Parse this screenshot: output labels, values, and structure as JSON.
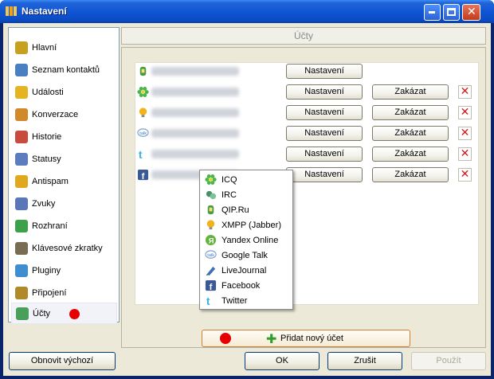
{
  "window": {
    "title": "Nastavení"
  },
  "sidebar": {
    "items": [
      {
        "label": "Hlavní",
        "icon": "home-icon",
        "color": "#c8a020"
      },
      {
        "label": "Seznam kontaktů",
        "icon": "contacts-icon",
        "color": "#4a7fc1"
      },
      {
        "label": "Události",
        "icon": "events-icon",
        "color": "#e6b422"
      },
      {
        "label": "Konverzace",
        "icon": "conversation-icon",
        "color": "#d08a2a"
      },
      {
        "label": "Historie",
        "icon": "history-icon",
        "color": "#c84b3c"
      },
      {
        "label": "Statusy",
        "icon": "status-icon",
        "color": "#5b7dbe"
      },
      {
        "label": "Antispam",
        "icon": "shield-icon",
        "color": "#e0a81c"
      },
      {
        "label": "Zvuky",
        "icon": "sound-icon",
        "color": "#5a78b8"
      },
      {
        "label": "Rozhraní",
        "icon": "interface-icon",
        "color": "#3da14a"
      },
      {
        "label": "Klávesové zkratky",
        "icon": "keyboard-icon",
        "color": "#7a6c52"
      },
      {
        "label": "Pluginy",
        "icon": "plugin-icon",
        "color": "#3f8fd0"
      },
      {
        "label": "Připojení",
        "icon": "connection-icon",
        "color": "#b08a2a"
      },
      {
        "label": "Účty",
        "icon": "accounts-icon",
        "color": "#4aa05a"
      }
    ]
  },
  "main": {
    "header": "Účty",
    "accounts": [
      {
        "icon": "qip-icon",
        "color": "#4a9a3e",
        "settings": "Nastavení"
      },
      {
        "icon": "icq-icon",
        "color": "#49b649",
        "settings": "Nastavení",
        "disable": "Zakázat"
      },
      {
        "icon": "xmpp-icon",
        "color": "#f2b21c",
        "settings": "Nastavení",
        "disable": "Zakázat"
      },
      {
        "icon": "google-talk-icon",
        "color": "#8aa1c9",
        "settings": "Nastavení",
        "disable": "Zakázat"
      },
      {
        "icon": "twitter-icon",
        "color": "#39b3e6",
        "settings": "Nastavení",
        "disable": "Zakázat"
      },
      {
        "icon": "facebook-icon",
        "color": "#3b5998",
        "settings": "Nastavení",
        "disable": "Zakázat"
      }
    ],
    "add_account": "Přidat nový účet"
  },
  "menu": {
    "items": [
      {
        "label": "ICQ",
        "icon": "icq-icon",
        "color": "#49b649"
      },
      {
        "label": "IRC",
        "icon": "irc-icon",
        "color": "#4a8f6a"
      },
      {
        "label": "QIP.Ru",
        "icon": "qip-icon",
        "color": "#4a9a3e"
      },
      {
        "label": "XMPP (Jabber)",
        "icon": "xmpp-icon",
        "color": "#f2b21c"
      },
      {
        "label": "Yandex Online",
        "icon": "yandex-icon",
        "color": "#62b43c"
      },
      {
        "label": "Google Talk",
        "icon": "google-talk-icon",
        "color": "#8aa1c9"
      },
      {
        "label": "LiveJournal",
        "icon": "livejournal-icon",
        "color": "#3f6fb5"
      },
      {
        "label": "Facebook",
        "icon": "facebook-icon",
        "color": "#3b5998"
      },
      {
        "label": "Twitter",
        "icon": "twitter-icon",
        "color": "#39b3e6"
      }
    ]
  },
  "footer": {
    "reset": "Obnovit výchozí",
    "ok": "OK",
    "cancel": "Zrušit",
    "apply": "Použít"
  }
}
